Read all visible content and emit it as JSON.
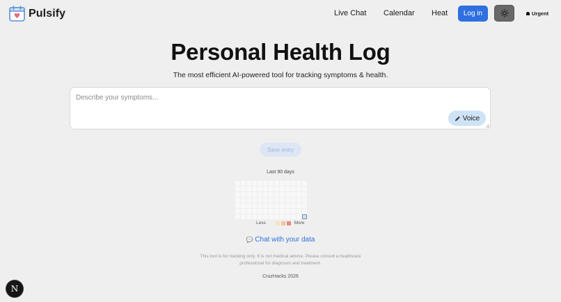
{
  "brand": {
    "name": "Pulsify",
    "icon": "calendar-heart-icon"
  },
  "nav": {
    "live_chat": "Live Chat",
    "calendar": "Calendar",
    "heat": "Heat",
    "login": "Log in",
    "theme_icon": "sun-icon",
    "urgent": "Urgent"
  },
  "hero": {
    "title": "Personal Health Log",
    "subtitle": "The most efficient AI-powered tool for tracking symptoms & health."
  },
  "entry": {
    "placeholder": "Describe your symptoms...",
    "voice_label": "Voice",
    "save_label": "Save entry"
  },
  "heatmap": {
    "label": "Last 90 days",
    "less": "Less",
    "more": "More",
    "legend_colors": [
      "#f3e6b8",
      "#f0c4a0",
      "#e8897e"
    ],
    "entries_logged_today": 1
  },
  "chat_link": "Chat with your data",
  "disclaimer": "This tool is for tracking only. It is not medical advice. Please consult a healthcare professional for diagnosis and treatment.",
  "footer": "CruzHacks 2026",
  "dev_badge": "N",
  "colors": {
    "accent": "#2f6fe0",
    "background": "#efefef"
  }
}
